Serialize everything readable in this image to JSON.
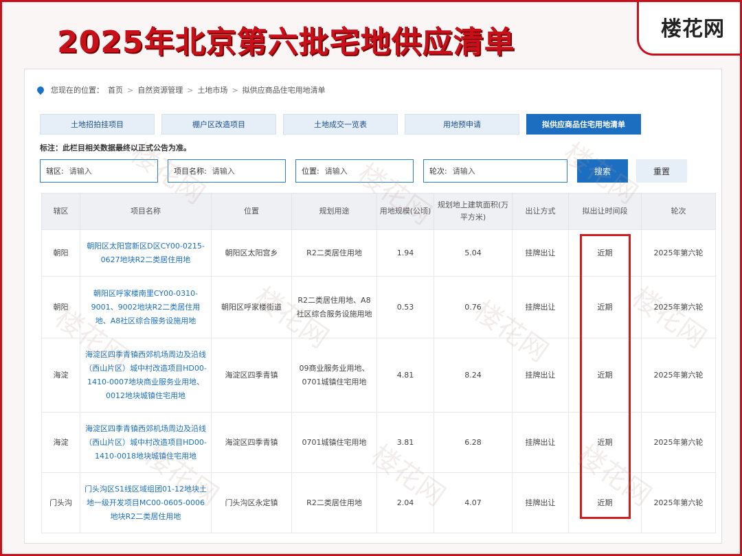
{
  "title": "2025年北京第六批宅地供应清单",
  "logo": "楼花网",
  "breadcrumb": {
    "prefix": "您现在的位置：",
    "items": [
      "首页",
      "自然资源管理",
      "土地市场",
      "拟供应商品住宅用地清单"
    ],
    "separator": ">"
  },
  "tabs": [
    "土地招拍挂项目",
    "棚户区改造项目",
    "土地成交一览表",
    "用地预申请",
    "拟供应商品住宅用地清单"
  ],
  "notice": "标注：此栏目相关数据最终以正式公告为准。",
  "filters": [
    {
      "label": "辖区:",
      "placeholder": "请输入"
    },
    {
      "label": "项目名称:",
      "placeholder": "请输入"
    },
    {
      "label": "位置:",
      "placeholder": "请输入"
    },
    {
      "label": "轮次:",
      "placeholder": "请输入"
    }
  ],
  "buttons": {
    "search": "搜索",
    "reset": "重置"
  },
  "table": {
    "headers": [
      "辖区",
      "项目名称",
      "位置",
      "规划用途",
      "用地规模(公顷)",
      "规划地上建筑面积(万平方米)",
      "出让方式",
      "拟出让时间段",
      "轮次"
    ],
    "rows": [
      [
        "朝阳",
        "朝阳区太阳宫新区D区CY00-0215-0627地块R2二类居住用地",
        "朝阳区太阳宫乡",
        "R2二类居住用地",
        "1.94",
        "5.04",
        "挂牌出让",
        "近期",
        "2025年第六轮"
      ],
      [
        "朝阳",
        "朝阳区呼家楼南里CY00-0310-9001、9002地块R2二类居住用地、A8社区综合服务设施用地",
        "朝阳区呼家楼街道",
        "R2二类居住用地、A8社区综合服务设施用地",
        "0.53",
        "0.76",
        "挂牌出让",
        "近期",
        "2025年第六轮"
      ],
      [
        "海淀",
        "海淀区四季青镇西郊机场周边及沿线（西山片区）城中村改造项目HD00-1410-0007地块商业服务业用地、0012地块城镇住宅用地",
        "海淀区四季青镇",
        "09商业服务业用地、0701城镇住宅用地",
        "4.81",
        "8.24",
        "挂牌出让",
        "近期",
        "2025年第六轮"
      ],
      [
        "海淀",
        "海淀区四季青镇西郊机场周边及沿线（西山片区）城中村改造项目HD00-1410-0018地块城镇住宅用地",
        "海淀区四季青镇",
        "0701城镇住宅用地",
        "3.81",
        "6.28",
        "挂牌出让",
        "近期",
        "2025年第六轮"
      ],
      [
        "门头沟",
        "门头沟区S1线区域组团01-12地块土地一级开发项目MC00-0605-0006地块R2二类居住用地",
        "门头沟区永定镇",
        "R2二类居住用地",
        "2.04",
        "4.07",
        "挂牌出让",
        "近期",
        "2025年第六轮"
      ]
    ]
  },
  "colors": {
    "frame": "#c8101a",
    "primary": "#1c6fc0",
    "link": "#1a6fc0",
    "highlight": "#d21c1c"
  }
}
